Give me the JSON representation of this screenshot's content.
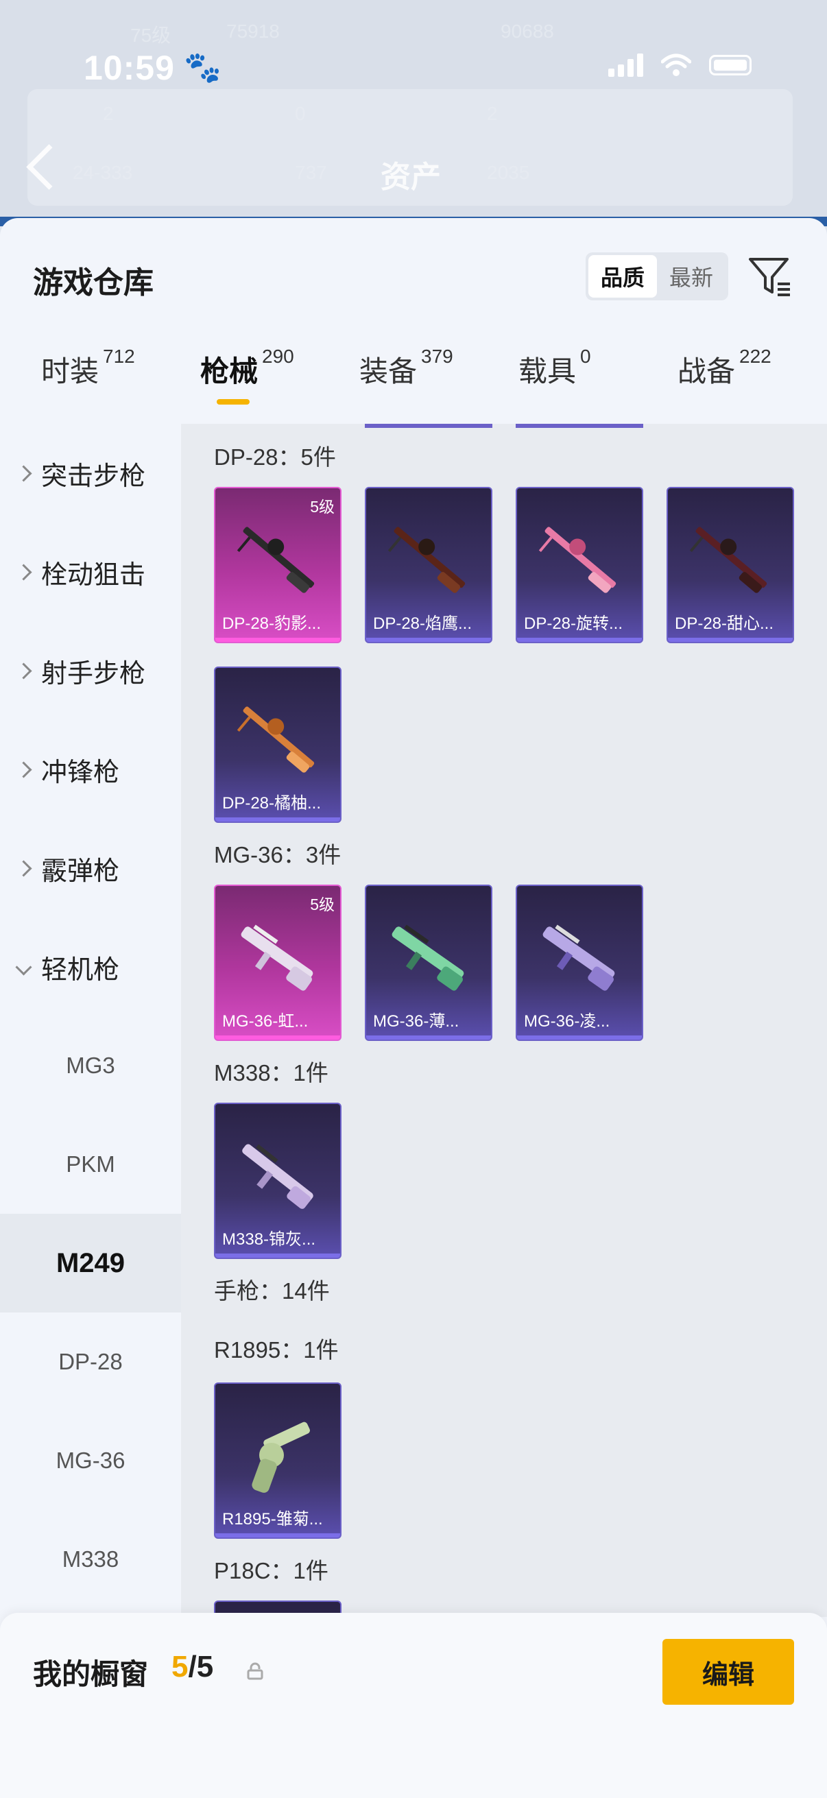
{
  "status_bar": {
    "time": "10:59"
  },
  "background_page": {
    "title": "资产",
    "ghost_texts": [
      "75级",
      "75918",
      "90688",
      "2",
      "0",
      "2",
      "24-333",
      "737",
      "2035"
    ]
  },
  "sheet": {
    "title": "游戏仓库",
    "sort": {
      "options": [
        "品质",
        "最新"
      ],
      "selected": "品质"
    }
  },
  "tabs": [
    {
      "label": "时装",
      "count": "712"
    },
    {
      "label": "枪械",
      "count": "290",
      "active": true
    },
    {
      "label": "装备",
      "count": "379"
    },
    {
      "label": "载具",
      "count": "0"
    },
    {
      "label": "战备",
      "count": "222"
    }
  ],
  "categories": [
    {
      "label": "突击步枪"
    },
    {
      "label": "栓动狙击"
    },
    {
      "label": "射手步枪"
    },
    {
      "label": "冲锋枪"
    },
    {
      "label": "霰弹枪"
    },
    {
      "label": "轻机枪",
      "open": true
    }
  ],
  "subcategories": [
    {
      "label": "MG3"
    },
    {
      "label": "PKM"
    },
    {
      "label": "M249",
      "active": true
    },
    {
      "label": "DP-28"
    },
    {
      "label": "MG-36"
    },
    {
      "label": "M338"
    }
  ],
  "sections": {
    "dp28": {
      "title": "DP-28：5件",
      "items": [
        {
          "name": "DP-28-豹影...",
          "level": "5级",
          "rarity": "pink"
        },
        {
          "name": "DP-28-焰鹰...",
          "rarity": "purple"
        },
        {
          "name": "DP-28-旋转...",
          "rarity": "purple"
        },
        {
          "name": "DP-28-甜心...",
          "rarity": "purple"
        },
        {
          "name": "DP-28-橘柚...",
          "rarity": "purple"
        }
      ]
    },
    "mg36": {
      "title": "MG-36：3件",
      "items": [
        {
          "name": "MG-36-虹...",
          "level": "5级",
          "rarity": "pink"
        },
        {
          "name": "MG-36-薄...",
          "rarity": "purple"
        },
        {
          "name": "MG-36-凌...",
          "rarity": "purple"
        }
      ]
    },
    "m338": {
      "title": "M338：1件",
      "items": [
        {
          "name": "M338-锦灰...",
          "rarity": "purple"
        }
      ]
    },
    "pistol": {
      "title": "手枪：14件"
    },
    "r1895": {
      "title": "R1895：1件",
      "items": [
        {
          "name": "R1895-雏菊...",
          "rarity": "purple"
        }
      ]
    },
    "p18c": {
      "title": "P18C：1件"
    }
  },
  "showcase": {
    "label": "我的橱窗",
    "current": "5",
    "separator": "/",
    "total": "5",
    "edit_label": "编辑"
  },
  "colors": {
    "accent": "#f6b300",
    "rarity_pink": "#d94ec6",
    "rarity_purple": "#5b4fb0"
  }
}
